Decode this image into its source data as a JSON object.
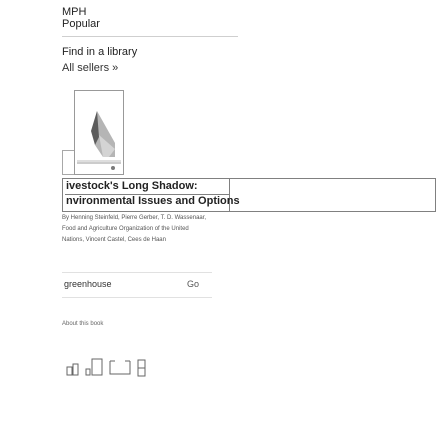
{
  "header": {
    "mph_label": "MPH",
    "popular_label": "Popular"
  },
  "library": {
    "find_label": "Find in a library",
    "sellers_label": "All sellers »"
  },
  "book": {
    "title_line1": "ivestock's Long Shadow:",
    "title_line2": "nvironmental Issues and Options",
    "authors_line1": "By Henning Steinfeld, Pierre Gerber, T. D. Wassenaar,",
    "authors_line2": "Food and Agriculture Organization of the United",
    "authors_line3": "Nations, Vincent Castel, Cees de Haan"
  },
  "search": {
    "value": "greenhouse",
    "go_label": "Go"
  },
  "about_label": "About this book",
  "icons": [
    "share-icon",
    "print-icon",
    "compose-icon",
    "bookmark-icon"
  ]
}
